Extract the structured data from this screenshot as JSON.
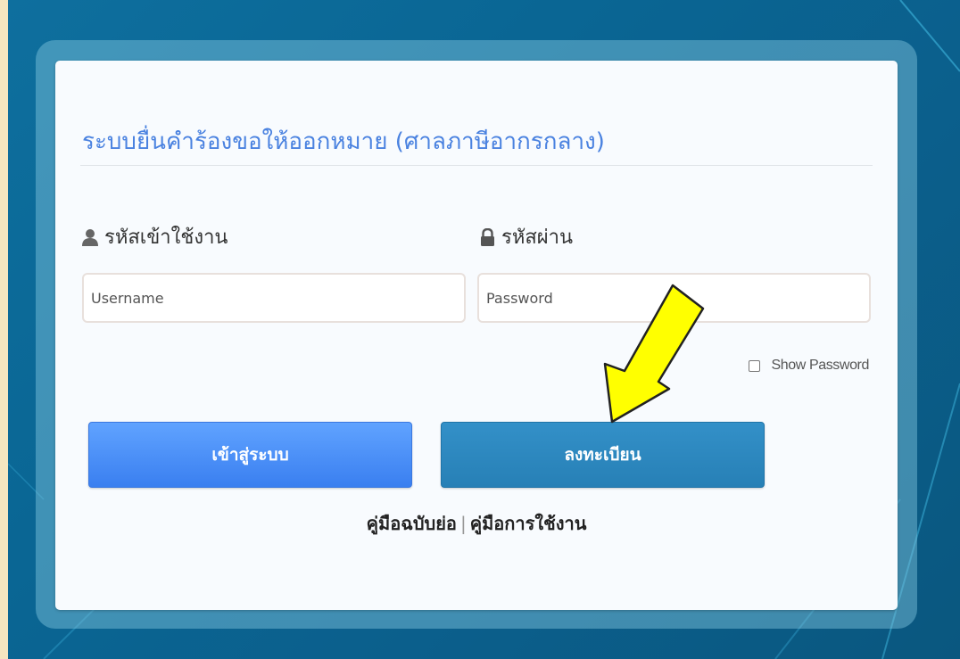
{
  "form": {
    "title": "ระบบยื่นคำร้องขอให้ออกหมาย (ศาลภาษีอากรกลาง)",
    "username_label": "รหัสเข้าใช้งาน",
    "password_label": "รหัสผ่าน",
    "username_placeholder": "Username",
    "password_placeholder": "Password",
    "show_password_label": "Show Password",
    "show_password_checked": false,
    "login_button": "เข้าสู่ระบบ",
    "register_button": "ลงทะเบียน"
  },
  "links": {
    "quick_manual": "คู่มือฉบับย่อ",
    "separator": "|",
    "user_manual": "คู่มือการใช้งาน"
  },
  "icons": {
    "user": "user-icon",
    "lock": "lock-icon",
    "annotation": "yellow-arrow-icon"
  },
  "colors": {
    "title": "#4a82e0",
    "login_button": "#4a8ff8",
    "register_button": "#2d88bf",
    "background": "#0a6694",
    "annotation_arrow": "#ffff00"
  }
}
